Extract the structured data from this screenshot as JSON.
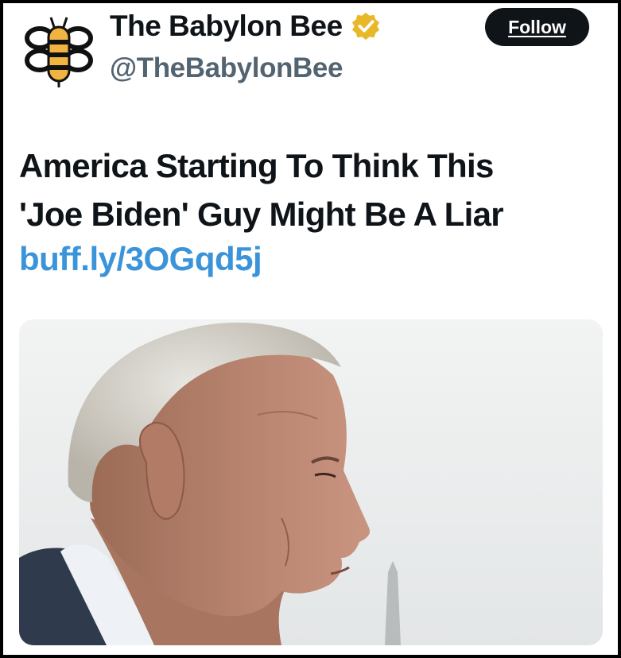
{
  "account": {
    "display_name": "The Babylon Bee",
    "handle": "@TheBabylonBee",
    "verified": true,
    "verified_color": "#e8b829",
    "logo_icon": "bee-logo-icon"
  },
  "follow_button": {
    "label": "Follow"
  },
  "post": {
    "headline_line1": "America Starting To Think This",
    "headline_line2": "'Joe Biden' Guy Might Be A Liar",
    "link_text": "buff.ly/3OGqd5j",
    "link_color": "#3b94d9"
  },
  "media": {
    "icon": "photo-elderly-man-profile"
  }
}
